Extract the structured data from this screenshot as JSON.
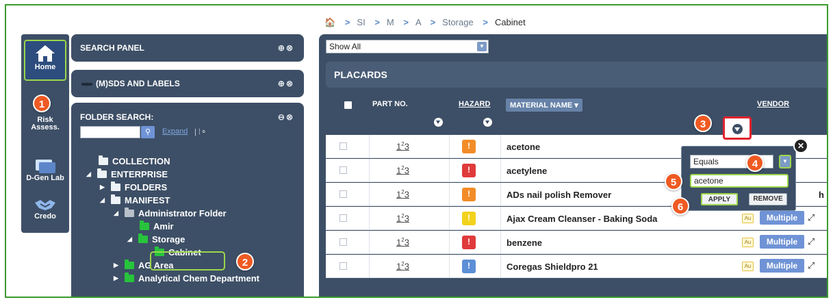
{
  "breadcrumb": [
    "SI",
    "M",
    "A",
    "Storage",
    "Cabinet"
  ],
  "rail": [
    {
      "label": "Home",
      "icon": "home-icon"
    },
    {
      "label": "Risk\nAssess.",
      "icon": "risk-assess-icon"
    },
    {
      "label": "D-Gen Lab",
      "icon": "lab-icon"
    },
    {
      "label": "Credo",
      "icon": "handshake-icon"
    }
  ],
  "panels": {
    "search_panel": "SEARCH PANEL",
    "msds": "(M)SDS AND LABELS",
    "folder_search": "FOLDER SEARCH:",
    "expand": "Expand"
  },
  "tree": [
    {
      "label": "COLLECTION"
    },
    {
      "label": "ENTERPRISE"
    },
    {
      "label": "FOLDERS"
    },
    {
      "label": "MANIFEST"
    },
    {
      "label": "Administrator Folder"
    },
    {
      "label": "Amir"
    },
    {
      "label": "Storage"
    },
    {
      "label": "Cabinet"
    },
    {
      "label": "AG Area"
    },
    {
      "label": "Analytical Chem Department"
    }
  ],
  "main": {
    "show_all": "Show All",
    "placards": "PLACARDS",
    "columns": {
      "part_no": "PART NO.",
      "hazard": "HAZARD",
      "material_name": "MATERIAL NAME ▾",
      "vendor": "VENDOR"
    }
  },
  "rows": [
    {
      "name": "acetone",
      "hazard_color": "#f28c28",
      "vendor": ""
    },
    {
      "name": "acetylene",
      "hazard_color": "#e03b3b",
      "vendor": ""
    },
    {
      "name": "ADs nail polish Remover",
      "hazard_color": "#f28c28",
      "vendor": "h"
    },
    {
      "name": "Ajax Cream Cleanser - Baking Soda",
      "hazard_color": "#f2d21c",
      "vendor": "Multiple"
    },
    {
      "name": "benzene",
      "hazard_color": "#e03b3b",
      "vendor": "Multiple"
    },
    {
      "name": "Coregas Shieldpro 21",
      "hazard_color": "#5c8fd6",
      "vendor": "Multiple"
    }
  ],
  "filter_popup": {
    "operator": "Equals",
    "value": "acetone",
    "apply": "APPLY",
    "remove": "REMOVE"
  },
  "part_no_glyph": "123",
  "au_badge": "Au",
  "badges": [
    "1",
    "2",
    "3",
    "4",
    "5",
    "6"
  ],
  "colors": {
    "panel_bg": "#3d4f66",
    "highlight_green": "#9bd64a",
    "badge_orange": "#ef5a22",
    "filter_red": "#e0232f"
  }
}
